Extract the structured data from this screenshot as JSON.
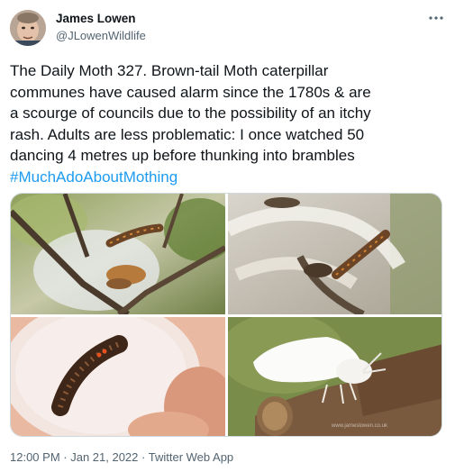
{
  "author": {
    "name": "James Lowen",
    "handle": "@JLowenWildlife"
  },
  "more_icon": "more-horizontal-icon",
  "tweet": {
    "lines": [
      "The Daily Moth 327. Brown-tail Moth caterpillar",
      "communes have caused alarm since the 1780s & are",
      "a scourge of councils due to the possibility of an itchy",
      "rash. Adults are less problematic: I once watched 50",
      "dancing 4 metres up before thunking into brambles"
    ],
    "hashtag": "#MuchAdoAboutMothing"
  },
  "media": {
    "photo_4_watermark": "www.jameslowen.co.uk"
  },
  "meta": {
    "time": "12:00 PM",
    "separator1": " · ",
    "date": "Jan 21, 2022",
    "separator2": " · ",
    "app": "Twitter Web App"
  },
  "colors": {
    "link": "#1d9bf0",
    "secondary_text": "#536471",
    "border": "#cfd9de"
  }
}
